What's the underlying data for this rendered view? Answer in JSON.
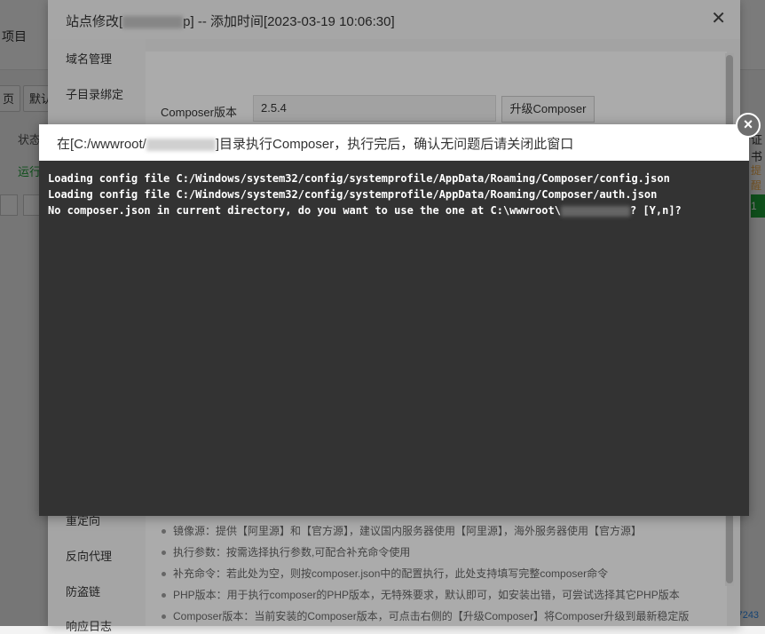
{
  "background": {
    "project_label": "项目",
    "btn_prev": "页",
    "btn_default": "默认",
    "status_label": "状态",
    "running_label": "运行",
    "right_tag_top": "证书",
    "right_tag": "提醒",
    "right_green": "1",
    "bottom_num": "▾ 7243"
  },
  "site_dialog": {
    "title_prefix": "站点修改[",
    "title_suffix": "p] -- 添加时间[2023-03-19 10:06:30]",
    "close_label": "✕",
    "sidebar": [
      "域名管理",
      "子目录绑定",
      "重定向",
      "反向代理",
      "防盗链",
      "响应日志"
    ],
    "composer_version_label": "Composer版本",
    "composer_version_value": "2.5.4",
    "upgrade_button": "升级Composer",
    "help": [
      "镜像源：提供【阿里源】和【官方源】，建议国内服务器使用【阿里源】，海外服务器使用【官方源】",
      "执行参数：按需选择执行参数,可配合补充命令使用",
      "补充命令：若此处为空，则按composer.json中的配置执行，此处支持填写完整composer命令",
      "PHP版本：用于执行composer的PHP版本，无特殊要求，默认即可，如安装出错，可尝试选择其它PHP版本",
      "Composer版本：当前安装的Composer版本，可点击右侧的【升级Composer】将Composer升级到最新稳定版"
    ]
  },
  "terminal": {
    "title_prefix": "在[C:/wwwroot/",
    "title_suffix": "]目录执行Composer，执行完后，确认无问题后请关闭此窗口",
    "close_label": "×",
    "line1": "Loading config file C:/Windows/system32/config/systemprofile/AppData/Roaming/Composer/config.json",
    "line2": "Loading config file C:/Windows/system32/config/systemprofile/AppData/Roaming/Composer/auth.json",
    "line3_prefix": "No composer.json in current directory, do you want to use the one at C:\\wwwroot\\",
    "line3_suffix": "? [Y,n]?"
  },
  "colors": {
    "terminal_bg": "#333333",
    "accent_green": "#20a53a"
  }
}
